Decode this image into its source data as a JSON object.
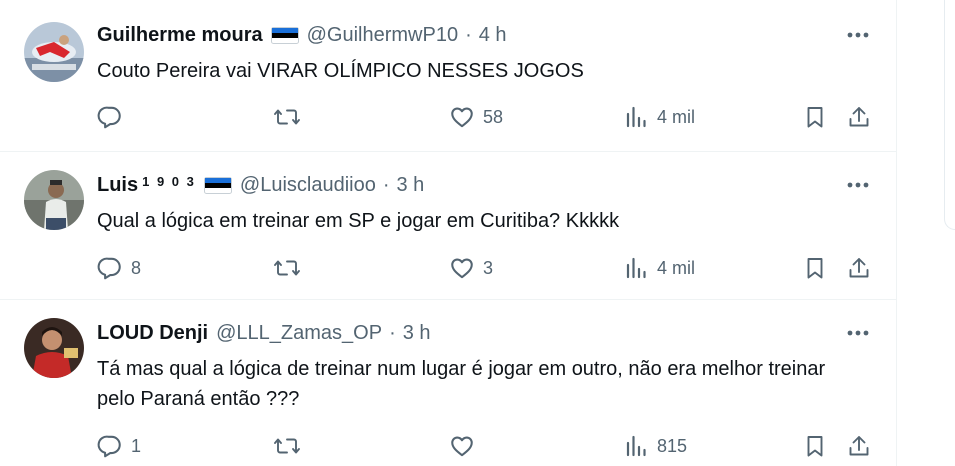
{
  "tweets": [
    {
      "name": "Guilherme moura",
      "name_suffix": "",
      "handle": "@GuilhermwP10",
      "dot": "·",
      "time": "4 h",
      "text": "Couto Pereira vai VIRAR OLÍMPICO NESSES JOGOS",
      "replies": "",
      "retweets": "",
      "likes": "58",
      "views": "4 mil"
    },
    {
      "name": "Luis",
      "name_suffix": "1 9 0 3",
      "handle": "@Luisclaudiioo",
      "dot": "·",
      "time": "3 h",
      "text": "Qual a lógica em treinar em SP e jogar em Curitiba? Kkkkk",
      "replies": "8",
      "retweets": "",
      "likes": "3",
      "views": "4 mil"
    },
    {
      "name": "LOUD Denji",
      "name_suffix": "",
      "handle": "@LLL_Zamas_OP",
      "dot": "·",
      "time": "3 h",
      "text": "Tá mas qual a lógica de treinar num lugar é jogar em outro, não era melhor treinar pelo Paraná então ???",
      "replies": "1",
      "retweets": "",
      "likes": "",
      "views": "815"
    }
  ],
  "icons": {
    "more": "more-icon",
    "reply": "reply-icon",
    "retweet": "retweet-icon",
    "like": "heart-icon",
    "views": "views-icon",
    "bookmark": "bookmark-icon",
    "share": "share-icon",
    "flag": "flag-icon"
  },
  "colors": {
    "text": "#0f1419",
    "secondary": "#536471",
    "divider": "#eff3f4",
    "flag_top": "#1a6fd8",
    "flag_middle": "#000000",
    "flag_bottom": "#ffffff"
  }
}
